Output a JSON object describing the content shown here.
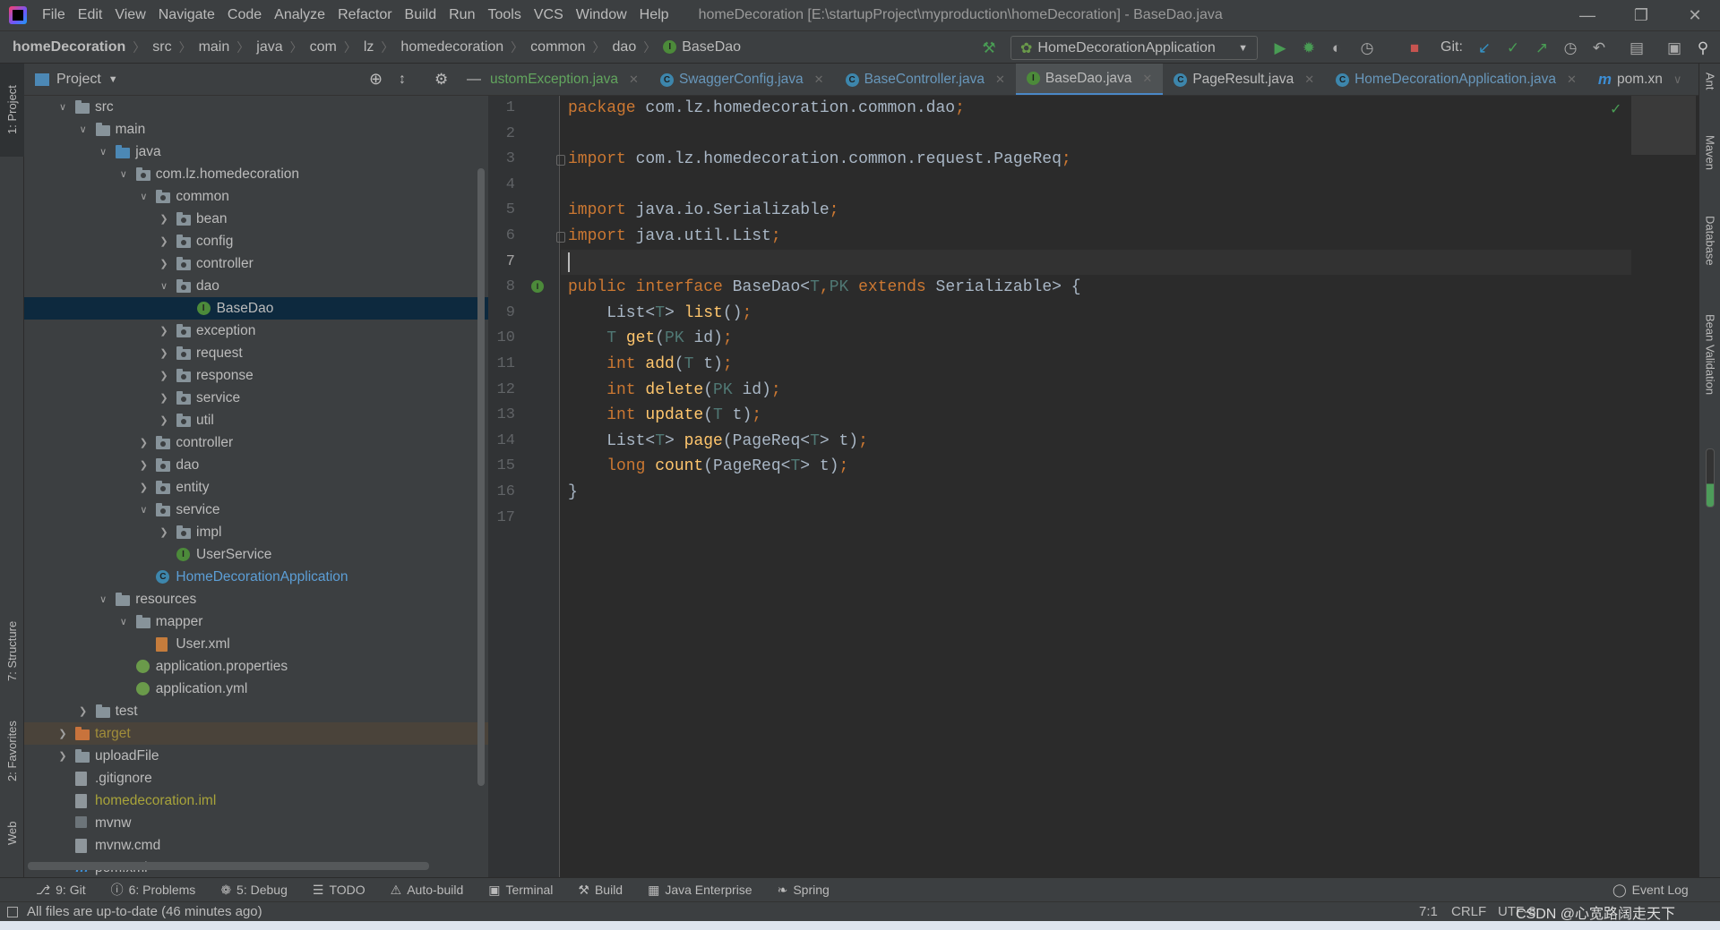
{
  "app": {
    "menu": [
      "File",
      "Edit",
      "View",
      "Navigate",
      "Code",
      "Analyze",
      "Refactor",
      "Build",
      "Run",
      "Tools",
      "VCS",
      "Window",
      "Help"
    ],
    "window_title": "homeDecoration [E:\\startupProject\\myproduction\\homeDecoration] - BaseDao.java",
    "window_controls": [
      "minimize-icon",
      "restore-icon",
      "close-icon"
    ]
  },
  "breadcrumb": [
    "homeDecoration",
    "src",
    "main",
    "java",
    "com",
    "lz",
    "homedecoration",
    "common",
    "dao",
    "BaseDao"
  ],
  "toolbar": {
    "run_config": "HomeDecorationApplication",
    "git_label": "Git:",
    "colors": {
      "run": "#499c54",
      "stop": "#c75450",
      "git_update": "#3592c4"
    }
  },
  "project_panel": {
    "title": "Project",
    "tree": [
      {
        "label": "src",
        "level": 0,
        "type": "folder",
        "state": "open"
      },
      {
        "label": "main",
        "level": 1,
        "type": "folder",
        "state": "open"
      },
      {
        "label": "java",
        "level": 2,
        "type": "folder-blue",
        "state": "open"
      },
      {
        "label": "com.lz.homedecoration",
        "level": 3,
        "type": "package",
        "state": "open"
      },
      {
        "label": "common",
        "level": 4,
        "type": "package",
        "state": "open"
      },
      {
        "label": "bean",
        "level": 5,
        "type": "package",
        "state": "closed"
      },
      {
        "label": "config",
        "level": 5,
        "type": "package",
        "state": "closed"
      },
      {
        "label": "controller",
        "level": 5,
        "type": "package",
        "state": "closed"
      },
      {
        "label": "dao",
        "level": 5,
        "type": "package",
        "state": "open"
      },
      {
        "label": "BaseDao",
        "level": 6,
        "type": "interface",
        "selected": true
      },
      {
        "label": "exception",
        "level": 5,
        "type": "package",
        "state": "closed"
      },
      {
        "label": "request",
        "level": 5,
        "type": "package",
        "state": "closed"
      },
      {
        "label": "response",
        "level": 5,
        "type": "package",
        "state": "closed"
      },
      {
        "label": "service",
        "level": 5,
        "type": "package",
        "state": "closed"
      },
      {
        "label": "util",
        "level": 5,
        "type": "package",
        "state": "closed"
      },
      {
        "label": "controller",
        "level": 4,
        "type": "package",
        "state": "closed"
      },
      {
        "label": "dao",
        "level": 4,
        "type": "package",
        "state": "closed"
      },
      {
        "label": "entity",
        "level": 4,
        "type": "package",
        "state": "closed"
      },
      {
        "label": "service",
        "level": 4,
        "type": "package",
        "state": "open"
      },
      {
        "label": "impl",
        "level": 5,
        "type": "package",
        "state": "closed"
      },
      {
        "label": "UserService",
        "level": 5,
        "type": "interface"
      },
      {
        "label": "HomeDecorationApplication",
        "level": 4,
        "type": "class",
        "color": "#5c9ed6"
      },
      {
        "label": "resources",
        "level": 2,
        "type": "folder",
        "state": "open"
      },
      {
        "label": "mapper",
        "level": 3,
        "type": "folder",
        "state": "open"
      },
      {
        "label": "User.xml",
        "level": 4,
        "type": "xml"
      },
      {
        "label": "application.properties",
        "level": 3,
        "type": "yml"
      },
      {
        "label": "application.yml",
        "level": 3,
        "type": "yml"
      },
      {
        "label": "test",
        "level": 1,
        "type": "folder",
        "state": "closed"
      },
      {
        "label": "target",
        "level": 0,
        "type": "folder-orange",
        "state": "closed",
        "highlight": true,
        "color": "#a08d3a"
      },
      {
        "label": "uploadFile",
        "level": 0,
        "type": "folder",
        "state": "closed"
      },
      {
        "label": ".gitignore",
        "level": 0,
        "type": "file"
      },
      {
        "label": "homedecoration.iml",
        "level": 0,
        "type": "file",
        "color": "#a8a33a"
      },
      {
        "label": "mvnw",
        "level": 0,
        "type": "exe"
      },
      {
        "label": "mvnw.cmd",
        "level": 0,
        "type": "file"
      },
      {
        "label": "pom.xml",
        "level": 0,
        "type": "maven"
      }
    ]
  },
  "tabs": [
    {
      "label": "ustomException.java",
      "icon": "none",
      "style": "green"
    },
    {
      "label": "SwaggerConfig.java",
      "icon": "class"
    },
    {
      "label": "BaseController.java",
      "icon": "class"
    },
    {
      "label": "BaseDao.java",
      "icon": "interface",
      "active": true
    },
    {
      "label": "PageResult.java",
      "icon": "class",
      "style": "plain"
    },
    {
      "label": "HomeDecorationApplication.java",
      "icon": "class"
    },
    {
      "label": "pom.xn",
      "icon": "maven",
      "style": "plain",
      "noclose": true
    }
  ],
  "editor": {
    "current_line": 7,
    "lines": [
      [
        [
          "package ",
          "k"
        ],
        [
          "com.lz.homedecoration.common.dao",
          "pl"
        ],
        [
          ";",
          "sc"
        ]
      ],
      [],
      [
        [
          "import ",
          "k"
        ],
        [
          "com.lz.homedecoration.common.request.PageReq",
          "pl"
        ],
        [
          ";",
          "sc"
        ]
      ],
      [],
      [
        [
          "import ",
          "k"
        ],
        [
          "java.io.Serializable",
          "pl"
        ],
        [
          ";",
          "sc"
        ]
      ],
      [
        [
          "import ",
          "k"
        ],
        [
          "java.util.List",
          "pl"
        ],
        [
          ";",
          "sc"
        ]
      ],
      [],
      [
        [
          "public interface ",
          "k"
        ],
        [
          "BaseDao<",
          "pl"
        ],
        [
          "T",
          "tp"
        ],
        [
          ",",
          "sc"
        ],
        [
          "PK ",
          "tp"
        ],
        [
          "extends ",
          "k"
        ],
        [
          "Serializable> {",
          "pl"
        ]
      ],
      [
        [
          "    List<",
          "pl"
        ],
        [
          "T",
          "tp"
        ],
        [
          "> ",
          "pl"
        ],
        [
          "list",
          "fn"
        ],
        [
          "()",
          "pl"
        ],
        [
          ";",
          "sc"
        ]
      ],
      [
        [
          "    ",
          "pl"
        ],
        [
          "T ",
          "tp"
        ],
        [
          "get",
          "fn"
        ],
        [
          "(",
          "pl"
        ],
        [
          "PK ",
          "tp"
        ],
        [
          "id)",
          "pl"
        ],
        [
          ";",
          "sc"
        ]
      ],
      [
        [
          "    int ",
          "k"
        ],
        [
          "add",
          "fn"
        ],
        [
          "(",
          "pl"
        ],
        [
          "T ",
          "tp"
        ],
        [
          "t)",
          "pl"
        ],
        [
          ";",
          "sc"
        ]
      ],
      [
        [
          "    int ",
          "k"
        ],
        [
          "delete",
          "fn"
        ],
        [
          "(",
          "pl"
        ],
        [
          "PK ",
          "tp"
        ],
        [
          "id)",
          "pl"
        ],
        [
          ";",
          "sc"
        ]
      ],
      [
        [
          "    int ",
          "k"
        ],
        [
          "update",
          "fn"
        ],
        [
          "(",
          "pl"
        ],
        [
          "T ",
          "tp"
        ],
        [
          "t)",
          "pl"
        ],
        [
          ";",
          "sc"
        ]
      ],
      [
        [
          "    List<",
          "pl"
        ],
        [
          "T",
          "tp"
        ],
        [
          "> ",
          "pl"
        ],
        [
          "page",
          "fn"
        ],
        [
          "(PageReq<",
          "pl"
        ],
        [
          "T",
          "tp"
        ],
        [
          "> t)",
          "pl"
        ],
        [
          ";",
          "sc"
        ]
      ],
      [
        [
          "    long ",
          "k"
        ],
        [
          "count",
          "fn"
        ],
        [
          "(PageReq<",
          "pl"
        ],
        [
          "T",
          "tp"
        ],
        [
          "> t)",
          "pl"
        ],
        [
          ";",
          "sc"
        ]
      ],
      [
        [
          "}",
          "pl"
        ]
      ],
      []
    ]
  },
  "left_strip": [
    "1: Project",
    "7: Structure",
    "2: Favorites",
    "Web"
  ],
  "right_strip": [
    "Ant",
    "Maven",
    "Database",
    "Bean Validation"
  ],
  "bottom_tabs": [
    {
      "label": "9: Git",
      "icon": "git-branch-icon"
    },
    {
      "label": "6: Problems",
      "icon": "problems-icon"
    },
    {
      "label": "5: Debug",
      "icon": "bug-icon"
    },
    {
      "label": "TODO",
      "icon": "list-icon"
    },
    {
      "label": "Auto-build",
      "icon": "warning-icon"
    },
    {
      "label": "Terminal",
      "icon": "terminal-icon"
    },
    {
      "label": "Build",
      "icon": "hammer-icon"
    },
    {
      "label": "Java Enterprise",
      "icon": "java-enterprise-icon"
    },
    {
      "label": "Spring",
      "icon": "spring-icon"
    }
  ],
  "event_log": "Event Log",
  "status": {
    "message": "All files are up-to-date (46 minutes ago)",
    "position": "7:1",
    "line_sep": "CRLF",
    "encoding": "UTF-8",
    "watermark": "CSDN @心宽路阔走天下"
  }
}
